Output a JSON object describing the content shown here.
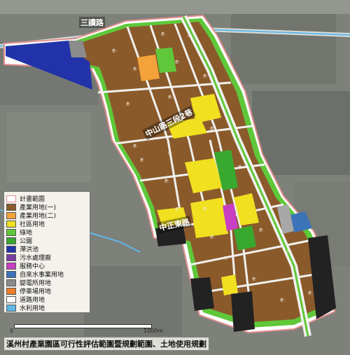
{
  "map": {
    "road_top_label": "三讀路",
    "road_zhongshan_label": "中山路三段2巷",
    "road_zhongzheng_label": "中正東路",
    "top_right_text": "",
    "parcel_tag": "產-",
    "caption": "溪州村產業園區可行性評估範圍暨規劃範圍、土地使用規劃",
    "scale_zero": "0",
    "scale_end": "1000m"
  },
  "legend": {
    "items": [
      {
        "label": "計畫範圍",
        "color": "#ffffff",
        "border": "#e58f8f"
      },
      {
        "label": "產業用地(一)",
        "color": "#8b5a2b"
      },
      {
        "label": "產業用地(二)",
        "color": "#f4a23c"
      },
      {
        "label": "社區用地",
        "color": "#f0e020"
      },
      {
        "label": "綠地",
        "color": "#5fc83a"
      },
      {
        "label": "公園",
        "color": "#39a82e"
      },
      {
        "label": "滯洪池",
        "color": "#2233aa"
      },
      {
        "label": "污水處理廠",
        "color": "#7a3da3"
      },
      {
        "label": "服務中心",
        "color": "#c93fc1"
      },
      {
        "label": "自來水事業用地",
        "color": "#3d73b8"
      },
      {
        "label": "變電所用地",
        "color": "#8c8c8c"
      },
      {
        "label": "停車場用地",
        "color": "#ef7f2a"
      },
      {
        "label": "道路用地",
        "color": "#ffffff"
      },
      {
        "label": "水利用地",
        "color": "#5fb8e8"
      }
    ]
  }
}
